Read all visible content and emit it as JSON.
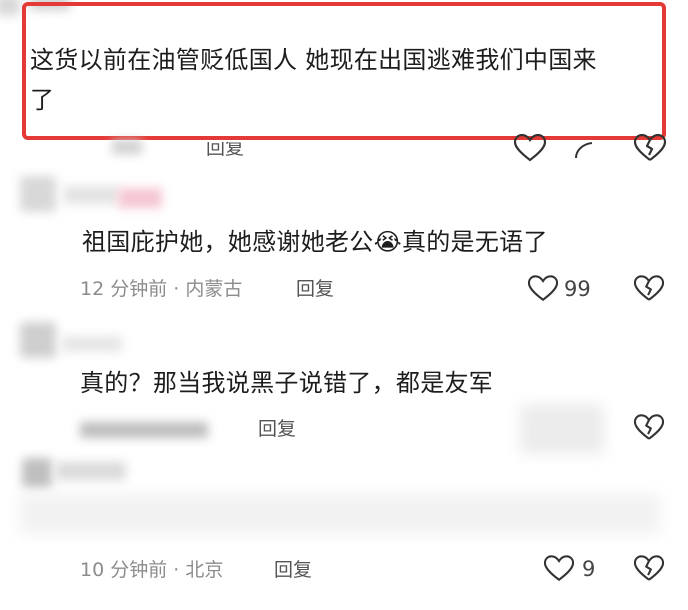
{
  "comments": [
    {
      "text_line1": "这货以前在油管贬低国人 她现在出国逃难我们中国来",
      "text_line2": "了",
      "reply_label": "回复"
    },
    {
      "text": "祖国庇护她，她感谢她老公",
      "text_after_emoji": "真的是无语了",
      "emoji": "😭",
      "time": "12 分钟前",
      "location": "内蒙古",
      "reply_label": "回复",
      "like_count": "99"
    },
    {
      "text": "真的？那当我说黑子说错了，都是友军",
      "reply_label": "回复"
    },
    {
      "time": "10 分钟前",
      "location": "北京",
      "reply_label": "回复",
      "like_count": "9"
    }
  ],
  "separator": "·",
  "colors": {
    "highlight_border": "#e53935",
    "meta_text": "#8c8c8c",
    "icon_stroke": "#333333"
  },
  "icons": [
    "heart-outline-icon",
    "broken-heart-icon",
    "crying-laughing-emoji"
  ]
}
